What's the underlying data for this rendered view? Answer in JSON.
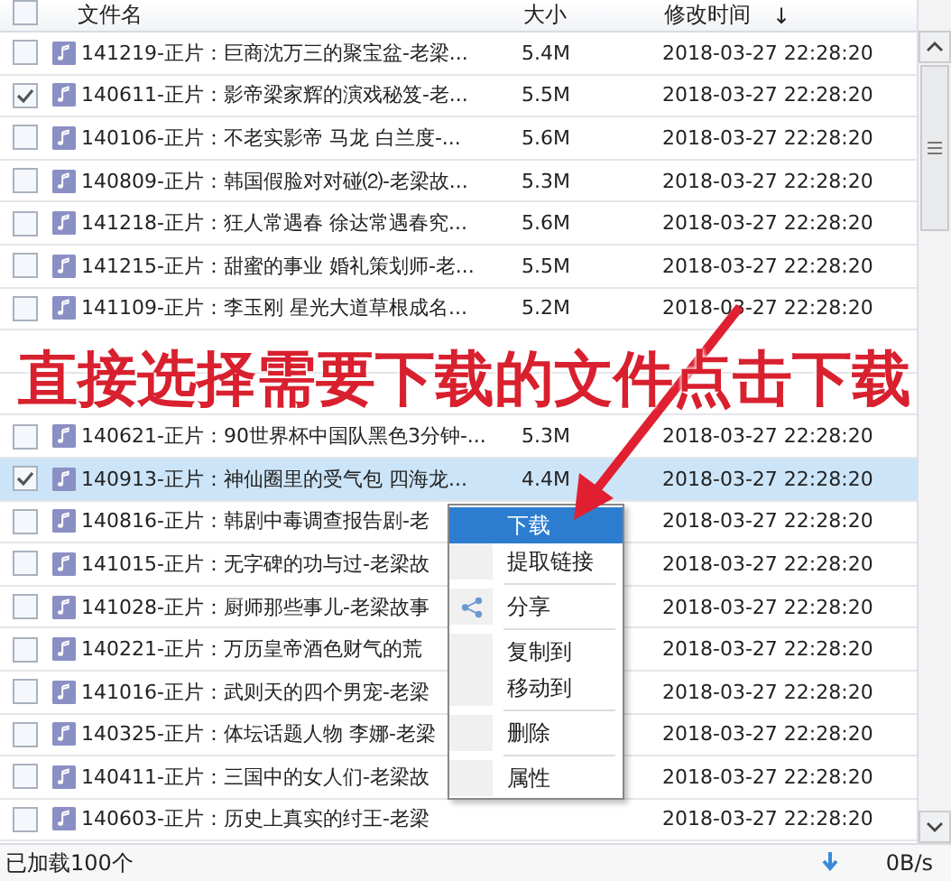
{
  "header": {
    "checked": false,
    "columns": [
      "文件名",
      "大小",
      "修改时间"
    ],
    "sort_indicator": "↓"
  },
  "rows": [
    {
      "name": "141219-正片：巨商沈万三的聚宝盆-老梁...",
      "size": "5.4M",
      "modified": "2018-03-27 22:28:20",
      "checked": false,
      "selected": false
    },
    {
      "name": "140611-正片：影帝梁家辉的演戏秘笈-老...",
      "size": "5.5M",
      "modified": "2018-03-27 22:28:20",
      "checked": true,
      "selected": false
    },
    {
      "name": "140106-正片：不老实影帝 马龙 白兰度-...",
      "size": "5.6M",
      "modified": "2018-03-27 22:28:20",
      "checked": false,
      "selected": false
    },
    {
      "name": "140809-正片：韩国假脸对对碰⑵-老梁故...",
      "size": "5.3M",
      "modified": "2018-03-27 22:28:20",
      "checked": false,
      "selected": false
    },
    {
      "name": "141218-正片：狂人常遇春 徐达常遇春究...",
      "size": "5.6M",
      "modified": "2018-03-27 22:28:20",
      "checked": false,
      "selected": false
    },
    {
      "name": "141215-正片：甜蜜的事业 婚礼策划师-老...",
      "size": "5.5M",
      "modified": "2018-03-27 22:28:20",
      "checked": false,
      "selected": false
    },
    {
      "name": "141109-正片：李玉刚 星光大道草根成名...",
      "size": "5.2M",
      "modified": "2018-03-27 22:28:20",
      "checked": false,
      "selected": false
    },
    {
      "selected": false
    },
    {
      "selected": false
    },
    {
      "name": "140621-正片：90世界杯中国队黑色3分钟-...",
      "size": "5.3M",
      "modified": "2018-03-27 22:28:20",
      "checked": false,
      "selected": false
    },
    {
      "name": "140913-正片：神仙圈里的受气包 四海龙...",
      "size": "4.4M",
      "modified": "2018-03-27 22:28:20",
      "checked": true,
      "selected": true
    },
    {
      "name": "140816-正片：韩剧中毒调查报告剧-老",
      "modified": "2018-03-27 22:28:20",
      "checked": false,
      "selected": false
    },
    {
      "name": "141015-正片：无字碑的功与过-老梁故",
      "modified": "2018-03-27 22:28:20",
      "checked": false,
      "selected": false
    },
    {
      "name": "141028-正片：厨师那些事儿-老梁故事",
      "modified": "2018-03-27 22:28:20",
      "checked": false,
      "selected": false
    },
    {
      "name": "140221-正片：万历皇帝酒色财气的荒",
      "modified": "2018-03-27 22:28:20",
      "checked": false,
      "selected": false
    },
    {
      "name": "141016-正片：武则天的四个男宠-老梁",
      "modified": "2018-03-27 22:28:20",
      "checked": false,
      "selected": false
    },
    {
      "name": "140325-正片：体坛话题人物 李娜-老梁",
      "modified": "2018-03-27 22:28:20",
      "checked": false,
      "selected": false
    },
    {
      "name": "140411-正片：三国中的女人们-老梁故",
      "modified": "2018-03-27 22:28:20",
      "checked": false,
      "selected": false
    },
    {
      "name": "140603-正片：历史上真实的纣王-老梁",
      "modified": "2018-03-27 22:28:20",
      "checked": false,
      "selected": false
    }
  ],
  "context_menu": {
    "items": [
      {
        "label": "下载",
        "kind": "plain",
        "selected": true,
        "separator_after": false
      },
      {
        "label": "提取链接",
        "kind": "plain",
        "selected": false,
        "separator_after": true
      },
      {
        "label": "分享",
        "kind": "share",
        "selected": false,
        "separator_after": true
      },
      {
        "label": "复制到",
        "kind": "plain",
        "selected": false,
        "separator_after": false
      },
      {
        "label": "移动到",
        "kind": "plain",
        "selected": false,
        "separator_after": true
      },
      {
        "label": "删除",
        "kind": "plain",
        "selected": false,
        "separator_after": true
      },
      {
        "label": "属性",
        "kind": "plain",
        "selected": false,
        "separator_after": false
      }
    ]
  },
  "annotation": {
    "text": "直接选择需要下载的文件点击下载"
  },
  "status_bar": {
    "loaded": "已加载100个",
    "speed": "0B/s"
  }
}
